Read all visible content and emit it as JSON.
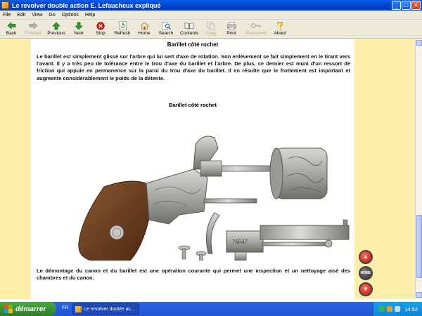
{
  "window": {
    "title": "Le revolver double action E. Lefaucheux expliqué"
  },
  "menu": {
    "items": [
      "File",
      "Edit",
      "View",
      "Go",
      "Options",
      "Help"
    ]
  },
  "toolbar": {
    "buttons": [
      {
        "label": "Back",
        "icon": "back-arrow-icon",
        "enabled": true
      },
      {
        "label": "Forward",
        "icon": "forward-arrow-icon",
        "enabled": false
      },
      {
        "label": "Previous",
        "icon": "previous-arrow-icon",
        "enabled": true
      },
      {
        "label": "Next",
        "icon": "next-arrow-icon",
        "enabled": true
      },
      {
        "label": "Stop",
        "icon": "stop-icon",
        "enabled": true
      },
      {
        "label": "Refresh",
        "icon": "refresh-icon",
        "enabled": true
      },
      {
        "label": "Home",
        "icon": "home-icon",
        "enabled": true
      },
      {
        "label": "Search",
        "icon": "search-icon",
        "enabled": true
      },
      {
        "label": "Contents",
        "icon": "contents-icon",
        "enabled": true
      },
      {
        "label": "Copy",
        "icon": "copy-icon",
        "enabled": false
      },
      {
        "label": "Print",
        "icon": "print-icon",
        "enabled": true
      },
      {
        "label": "Password",
        "icon": "key-icon",
        "enabled": false
      },
      {
        "label": "About",
        "icon": "about-icon",
        "enabled": true
      }
    ]
  },
  "page": {
    "heading": "Barillet côté rochet",
    "paragraph1": "Le barillet est simplement glissé sur l'arbre qui lui sert d'axe de rotation. Son enlèvement se fait simplement en le tirant vers l'avant. Il y a très peu de tolérance entre le trou d'axe du barillet et l'arbre. De plus, ce dernier est muni d'un ressort de friction qui appuie en permanence sur la paroi du trou d'axe du barillet. Il en résulte que le frottement est important et augmente considérablement le poids de la détente.",
    "caption": "Barillet côté rochet",
    "serial_engraving": "76047",
    "paragraph2": "Le démontage du canon et du barillet est une opération courante qui permet une inspection et un nettoyage aisé des chambres et du canon."
  },
  "nav": {
    "home_label": "HOME"
  },
  "taskbar": {
    "start_label": "démarrer",
    "language": "FR",
    "task_label": "Le revolver double ac...",
    "clock": "14:52"
  },
  "colors": {
    "page_background": "#fbf5df",
    "side_band": "#fceda9",
    "title_bar": "#0348d4",
    "taskbar": "#245edc",
    "start_button": "#3b9232"
  }
}
